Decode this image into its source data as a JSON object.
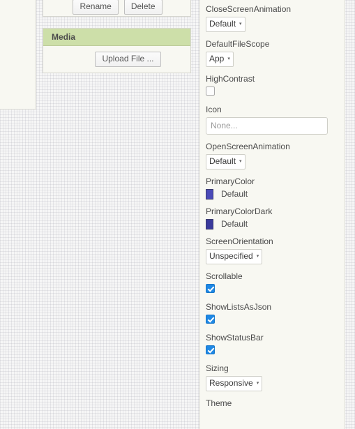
{
  "left_sidebar": {
    "name": "palette-strip"
  },
  "components_panel": {
    "rename_label": "Rename",
    "delete_label": "Delete"
  },
  "media_panel": {
    "title": "Media",
    "upload_label": "Upload File ..."
  },
  "properties_panel": {
    "items": [
      {
        "name": "CloseScreenAnimation",
        "type": "select",
        "value": "Default",
        "caret": "▾"
      },
      {
        "name": "DefaultFileScope",
        "type": "select",
        "value": "App",
        "caret": "▾"
      },
      {
        "name": "HighContrast",
        "type": "checkbox",
        "checked": false
      },
      {
        "name": "Icon",
        "type": "text",
        "value": "",
        "placeholder": "None..."
      },
      {
        "name": "OpenScreenAnimation",
        "type": "select",
        "value": "Default",
        "caret": "▾"
      },
      {
        "name": "PrimaryColor",
        "type": "color",
        "value": "Default",
        "swatch": "#4a4ab8"
      },
      {
        "name": "PrimaryColorDark",
        "type": "color",
        "value": "Default",
        "swatch": "#3a3a9c"
      },
      {
        "name": "ScreenOrientation",
        "type": "select",
        "value": "Unspecified",
        "caret": "▾"
      },
      {
        "name": "Scrollable",
        "type": "checkbox",
        "checked": true
      },
      {
        "name": "ShowListsAsJson",
        "type": "checkbox",
        "checked": true
      },
      {
        "name": "ShowStatusBar",
        "type": "checkbox",
        "checked": true
      },
      {
        "name": "Sizing",
        "type": "select",
        "value": "Responsive",
        "caret": "▾"
      },
      {
        "name": "Theme",
        "type": "label-only"
      }
    ]
  },
  "colors": {
    "panel_background": "#f8f8f2",
    "media_header": "#cddfa9",
    "checkbox_checked": "#1e88e5",
    "primary_color": "#4a4ab8",
    "primary_color_dark": "#3a3a9c"
  }
}
